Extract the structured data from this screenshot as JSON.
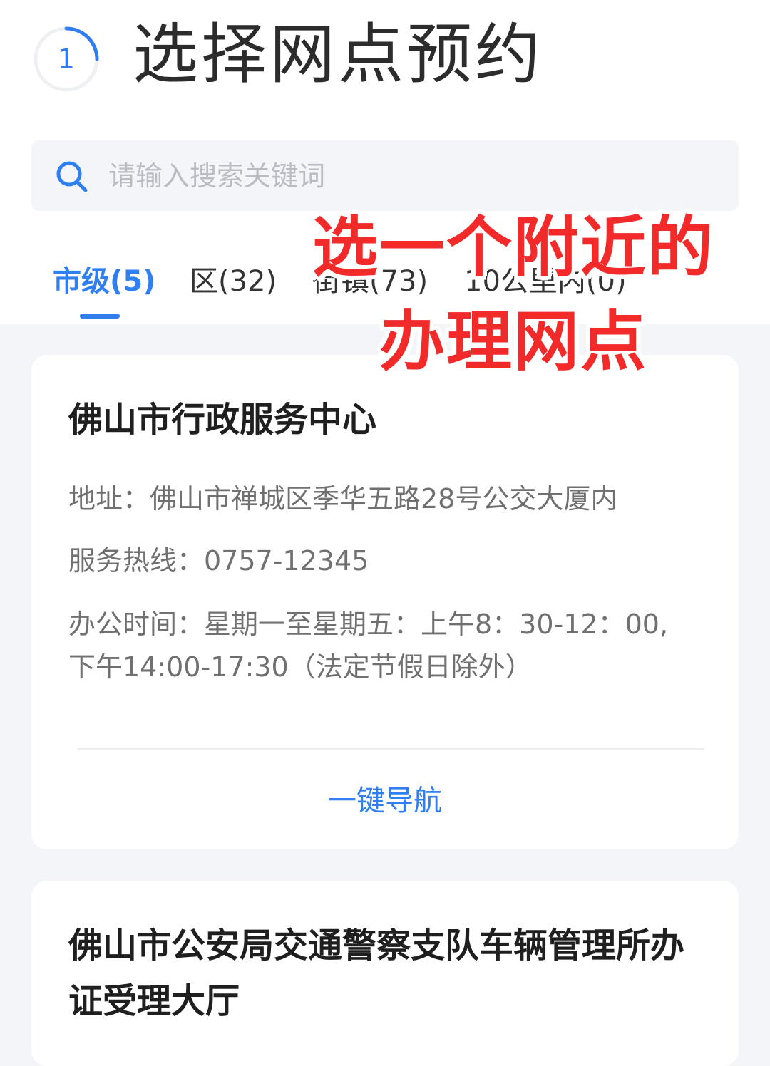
{
  "header": {
    "step_number": "1",
    "title": "选择网点预约"
  },
  "search": {
    "placeholder": "请输入搜索关键词"
  },
  "tabs": [
    {
      "label": "市级(5)",
      "active": true
    },
    {
      "label": "区(32)",
      "active": false
    },
    {
      "label": "街镇(73)",
      "active": false
    },
    {
      "label": "10公里内(0)",
      "active": false
    }
  ],
  "annotation": {
    "line1": "选一个附近的",
    "line2": "办理网点"
  },
  "cards": [
    {
      "name": "佛山市行政服务中心",
      "address": "地址：佛山市禅城区季华五路28号公交大厦内",
      "hotline": "服务热线：0757-12345",
      "hours": "办公时间：星期一至星期五：上午8：30-12：00,下午14:00-17:30（法定节假日除外）",
      "nav_label": "一键导航"
    },
    {
      "name": "佛山市公安局交通警察支队车辆管理所办证受理大厅"
    }
  ],
  "colors": {
    "accent": "#2f7ff0",
    "annotation_red": "#f22a2a",
    "background": "#f3f5f8"
  },
  "icons": {
    "search": "search-icon",
    "step": "step-progress-icon"
  }
}
